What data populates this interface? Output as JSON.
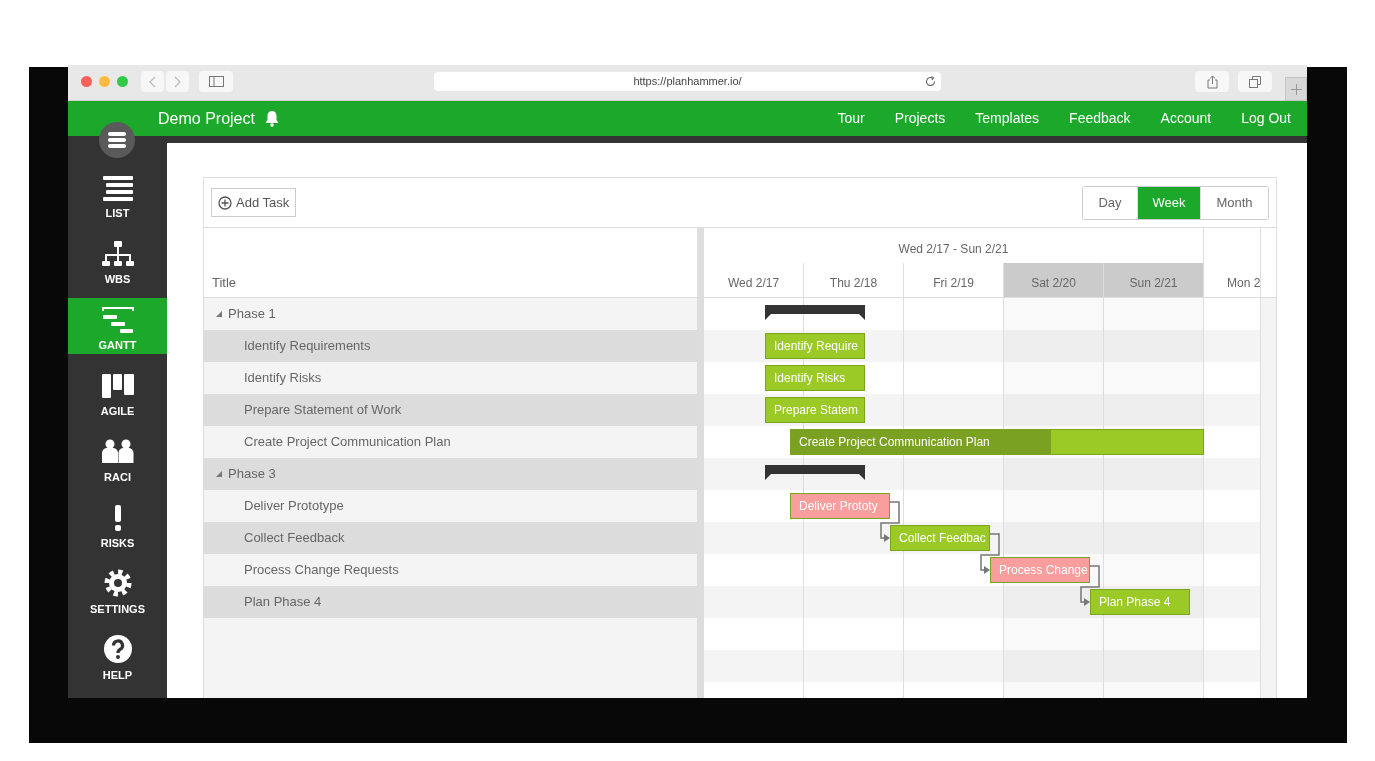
{
  "browser": {
    "url": "https://planhammer.io/"
  },
  "header": {
    "project": "Demo Project",
    "nav": [
      "Tour",
      "Projects",
      "Templates",
      "Feedback",
      "Account",
      "Log Out"
    ]
  },
  "sidebar": {
    "items": [
      {
        "label": "LIST",
        "selected": false
      },
      {
        "label": "WBS",
        "selected": false
      },
      {
        "label": "GANTT",
        "selected": true
      },
      {
        "label": "AGILE",
        "selected": false
      },
      {
        "label": "RACI",
        "selected": false
      },
      {
        "label": "RISKS",
        "selected": false
      },
      {
        "label": "SETTINGS",
        "selected": false
      },
      {
        "label": "HELP",
        "selected": false
      }
    ]
  },
  "toolbar": {
    "add_task": "Add Task",
    "views": [
      {
        "label": "Day",
        "selected": false
      },
      {
        "label": "Week",
        "selected": true
      },
      {
        "label": "Month",
        "selected": false
      }
    ]
  },
  "grid": {
    "title_column": "Title"
  },
  "timeline": {
    "range": "Wed 2/17 - Sun 2/21",
    "days": [
      {
        "label": "Wed 2/17",
        "weekend": false
      },
      {
        "label": "Thu 2/18",
        "weekend": false
      },
      {
        "label": "Fri 2/19",
        "weekend": false
      },
      {
        "label": "Sat 2/20",
        "weekend": true
      },
      {
        "label": "Sun 2/21",
        "weekend": true
      },
      {
        "label": "Mon 2",
        "weekend": false
      }
    ]
  },
  "tasks": [
    {
      "title": "Phase 1",
      "expanded": true,
      "children": [
        {
          "title": "Identify Requirements",
          "bar_label": "Identify Require",
          "color": "#9bc925",
          "linked_to_previous": false
        },
        {
          "title": "Identify Risks",
          "bar_label": "Identify Risks",
          "color": "#9bc925",
          "linked_to_previous": false
        },
        {
          "title": "Prepare Statement of Work",
          "bar_label": "Prepare Statem",
          "color": "#9bc925",
          "linked_to_previous": false
        },
        {
          "title": "Create Project Communication Plan",
          "bar_label": "Create Project Communication Plan",
          "color": "#9bc925",
          "level": 0.63,
          "linked_to_previous": false
        }
      ]
    },
    {
      "title": "Phase 3",
      "expanded": true,
      "children": [
        {
          "title": "Deliver Prototype",
          "bar_label": "Deliver Prototy",
          "color": "#f99d9d",
          "linked_to_previous": false
        },
        {
          "title": "Collect Feedback",
          "bar_label": "Collect Feedbac",
          "color": "#9bc925",
          "linked_to_previous": true
        },
        {
          "title": "Process Change Requests",
          "bar_label": "Process Change",
          "color": "#f99d9d",
          "linked_to_previous": true
        },
        {
          "title": "Plan Phase 4",
          "bar_label": "Plan Phase 4",
          "color": "#9bc925",
          "linked_to_previous": true
        }
      ]
    }
  ]
}
